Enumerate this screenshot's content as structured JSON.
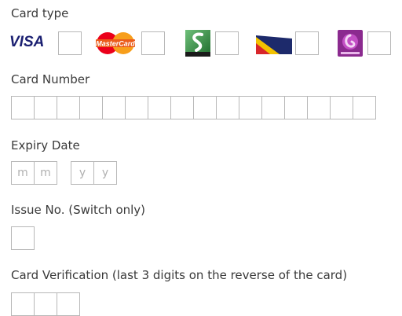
{
  "card_type": {
    "label": "Card type",
    "options": [
      {
        "name": "VISA",
        "logo": "visa-logo"
      },
      {
        "name": "MasterCard",
        "logo": "mastercard-logo"
      },
      {
        "name": "Switch",
        "logo": "switch-logo"
      },
      {
        "name": "Solo",
        "logo": "solo-logo"
      },
      {
        "name": "Maestro",
        "logo": "maestro-logo"
      }
    ]
  },
  "card_number": {
    "label": "Card Number",
    "digits": 16
  },
  "expiry": {
    "label": "Expiry Date",
    "month_placeholder": [
      "m",
      "m"
    ],
    "year_placeholder": [
      "y",
      "y"
    ]
  },
  "issue_no": {
    "label": "Issue No. (Switch only)"
  },
  "cvv": {
    "label": "Card Verification (last 3 digits on the reverse of the card)",
    "digits": 3
  },
  "colors": {
    "visa": "#1a1f71",
    "mastercard_red": "#eb001b",
    "mastercard_orange": "#f79e1b",
    "switch_green": "#2e8b3a",
    "maestro_purple": "#8b2a8f"
  }
}
